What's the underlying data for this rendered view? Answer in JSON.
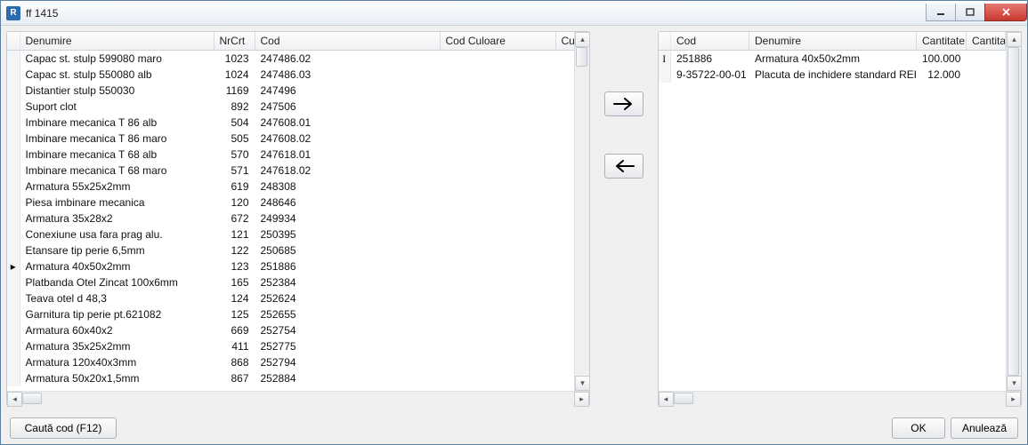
{
  "window": {
    "title": "ff 1415"
  },
  "left": {
    "headers": [
      "Denumire",
      "NrCrt",
      "Cod",
      "Cod Culoare",
      "Cu"
    ],
    "selected_index": 13,
    "rows": [
      {
        "den": "Capac st. stulp 599080 maro",
        "nr": "1023",
        "cod": "247486.02"
      },
      {
        "den": "Capac st. stulp 550080 alb",
        "nr": "1024",
        "cod": "247486.03"
      },
      {
        "den": "Distantier stulp 550030",
        "nr": "1169",
        "cod": "247496"
      },
      {
        "den": "Suport clot",
        "nr": "892",
        "cod": "247506"
      },
      {
        "den": "Imbinare mecanica T 86 alb",
        "nr": "504",
        "cod": "247608.01"
      },
      {
        "den": "Imbinare mecanica T 86 maro",
        "nr": "505",
        "cod": "247608.02"
      },
      {
        "den": "Imbinare mecanica T 68 alb",
        "nr": "570",
        "cod": "247618.01"
      },
      {
        "den": "Imbinare mecanica T 68 maro",
        "nr": "571",
        "cod": "247618.02"
      },
      {
        "den": "Armatura 55x25x2mm",
        "nr": "619",
        "cod": "248308"
      },
      {
        "den": "Piesa imbinare mecanica",
        "nr": "120",
        "cod": "248646"
      },
      {
        "den": "Armatura 35x28x2",
        "nr": "672",
        "cod": "249934"
      },
      {
        "den": "Conexiune usa fara prag alu.",
        "nr": "121",
        "cod": "250395"
      },
      {
        "den": "Etansare tip perie 6,5mm",
        "nr": "122",
        "cod": "250685"
      },
      {
        "den": "Armatura 40x50x2mm",
        "nr": "123",
        "cod": "251886"
      },
      {
        "den": "Platbanda Otel Zincat 100x6mm",
        "nr": "165",
        "cod": "252384"
      },
      {
        "den": "Teava otel d 48,3",
        "nr": "124",
        "cod": "252624"
      },
      {
        "den": "Garnitura tip perie pt.621082",
        "nr": "125",
        "cod": "252655"
      },
      {
        "den": "Armatura 60x40x2",
        "nr": "669",
        "cod": "252754"
      },
      {
        "den": "Armatura 35x25x2mm",
        "nr": "411",
        "cod": "252775"
      },
      {
        "den": "Armatura 120x40x3mm",
        "nr": "868",
        "cod": "252794"
      },
      {
        "den": "Armatura 50x20x1,5mm",
        "nr": "867",
        "cod": "252884"
      }
    ]
  },
  "right": {
    "headers": [
      "Cod",
      "Denumire",
      "Cantitate",
      "Cantita"
    ],
    "edit_index": 0,
    "rows": [
      {
        "cod": "251886",
        "den": "Armatura 40x50x2mm",
        "cant": "100.000"
      },
      {
        "cod": "9-35722-00-01",
        "den": "Placuta de inchidere standard REHAU",
        "cant": "12.000"
      }
    ]
  },
  "buttons": {
    "search": "Caută cod (F12)",
    "ok": "OK",
    "cancel": "Anulează"
  }
}
